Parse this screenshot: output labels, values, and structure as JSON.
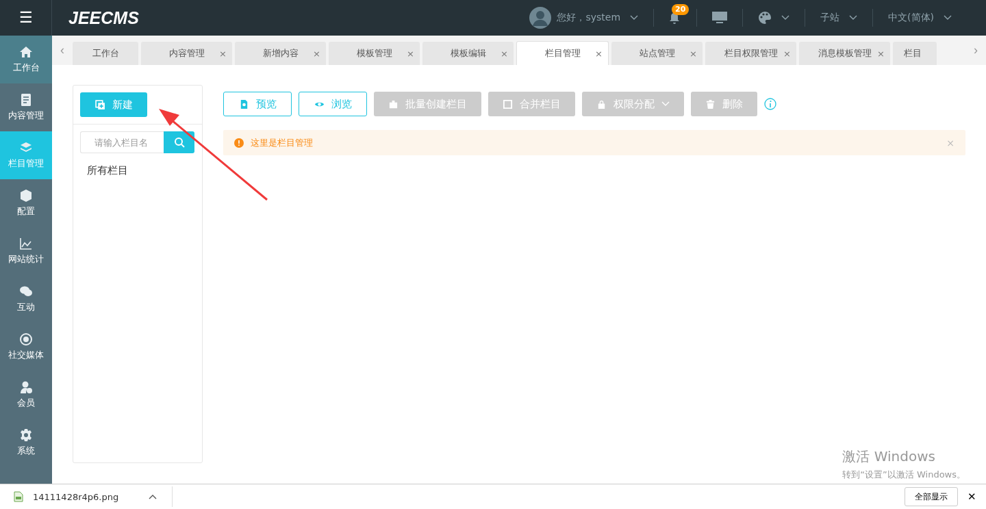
{
  "header": {
    "logo": "JEECMS",
    "menu_icon": "☰",
    "user_greeting": "您好，system",
    "notification_count": "20",
    "site_switch": "子站",
    "language": "中文(简体)"
  },
  "sidebar": {
    "items": [
      {
        "label": "工作台",
        "selected": false,
        "highlighted": true
      },
      {
        "label": "内容管理",
        "selected": false,
        "highlighted": false
      },
      {
        "label": "栏目管理",
        "selected": true,
        "highlighted": false
      },
      {
        "label": "配置",
        "selected": false,
        "highlighted": false
      },
      {
        "label": "网站统计",
        "selected": false,
        "highlighted": false
      },
      {
        "label": "互动",
        "selected": false,
        "highlighted": false
      },
      {
        "label": "社交媒体",
        "selected": false,
        "highlighted": false
      },
      {
        "label": "会员",
        "selected": false,
        "highlighted": false
      },
      {
        "label": "系统",
        "selected": false,
        "highlighted": false
      }
    ]
  },
  "tabs": {
    "prev": "‹",
    "next": "›",
    "items": [
      {
        "label": "工作台",
        "selected": false,
        "closable": false
      },
      {
        "label": "内容管理",
        "selected": false,
        "closable": true
      },
      {
        "label": "新增内容",
        "selected": false,
        "closable": true
      },
      {
        "label": "模板管理",
        "selected": false,
        "closable": true
      },
      {
        "label": "模板编辑",
        "selected": false,
        "closable": true
      },
      {
        "label": "栏目管理",
        "selected": true,
        "closable": true
      },
      {
        "label": "站点管理",
        "selected": false,
        "closable": true
      },
      {
        "label": "栏目权限管理",
        "selected": false,
        "closable": true
      },
      {
        "label": "消息模板管理",
        "selected": false,
        "closable": true
      },
      {
        "label": "栏目",
        "selected": false,
        "closable": false
      }
    ],
    "close": "×"
  },
  "tree_panel": {
    "new_button": "新建",
    "search": {
      "placeholder": "请输入栏目名"
    },
    "root": "所有栏目"
  },
  "toolbar": {
    "buttons": [
      {
        "label": "预览",
        "kind": "outline",
        "dropdown": false
      },
      {
        "label": "浏览",
        "kind": "outline",
        "dropdown": false
      },
      {
        "label": "批量创建栏目",
        "kind": "disabled",
        "dropdown": false
      },
      {
        "label": "合并栏目",
        "kind": "disabled",
        "dropdown": false
      },
      {
        "label": "权限分配",
        "kind": "disabled",
        "dropdown": true
      },
      {
        "label": "删除",
        "kind": "disabled",
        "dropdown": false
      }
    ]
  },
  "alert": {
    "message": "这里是栏目管理",
    "close": "×"
  },
  "activation_notice": {
    "title": "激活 Windows",
    "text": "转到“设置”以激活 Windows。"
  },
  "download_bar": {
    "file_name": "14111428r4p6.png",
    "show_all": "全部显示",
    "close": "✕"
  }
}
